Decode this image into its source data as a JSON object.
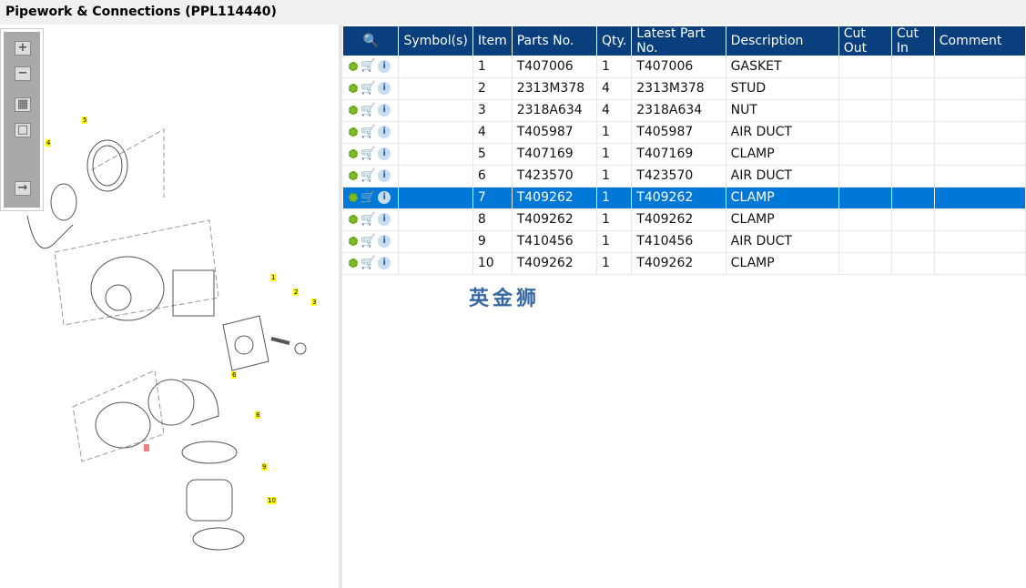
{
  "title": "Pipework & Connections (PPL114440)",
  "toolbar": {
    "icons": [
      "zoom-in-icon",
      "zoom-out-icon",
      "fit-all-icon",
      "fit-page-icon",
      "expand-panel-icon"
    ]
  },
  "diagram": {
    "callouts": [
      "5",
      "4",
      "1",
      "2",
      "3",
      "6",
      "8",
      "9",
      "10",
      "7"
    ]
  },
  "table": {
    "headers": [
      "",
      "Symbol(s)",
      "Item",
      "Parts No.",
      "Qty.",
      "Latest Part No.",
      "Description",
      "Cut Out",
      "Cut In",
      "Comment"
    ],
    "rows": [
      {
        "item": "1",
        "part": "T407006",
        "qty": "1",
        "latest": "T407006",
        "desc": "GASKET"
      },
      {
        "item": "2",
        "part": "2313M378",
        "qty": "4",
        "latest": "2313M378",
        "desc": "STUD"
      },
      {
        "item": "3",
        "part": "2318A634",
        "qty": "4",
        "latest": "2318A634",
        "desc": "NUT"
      },
      {
        "item": "4",
        "part": "T405987",
        "qty": "1",
        "latest": "T405987",
        "desc": "AIR DUCT"
      },
      {
        "item": "5",
        "part": "T407169",
        "qty": "1",
        "latest": "T407169",
        "desc": "CLAMP"
      },
      {
        "item": "6",
        "part": "T423570",
        "qty": "1",
        "latest": "T423570",
        "desc": "AIR DUCT"
      },
      {
        "item": "7",
        "part": "T409262",
        "qty": "1",
        "latest": "T409262",
        "desc": "CLAMP"
      },
      {
        "item": "8",
        "part": "T409262",
        "qty": "1",
        "latest": "T409262",
        "desc": "CLAMP"
      },
      {
        "item": "9",
        "part": "T410456",
        "qty": "1",
        "latest": "T410456",
        "desc": "AIR DUCT"
      },
      {
        "item": "10",
        "part": "T409262",
        "qty": "1",
        "latest": "T409262",
        "desc": "CLAMP"
      }
    ],
    "selected_item": "7"
  },
  "watermark": "英金狮",
  "colors": {
    "header": "#0a3f7d",
    "selected": "#0078d7"
  }
}
